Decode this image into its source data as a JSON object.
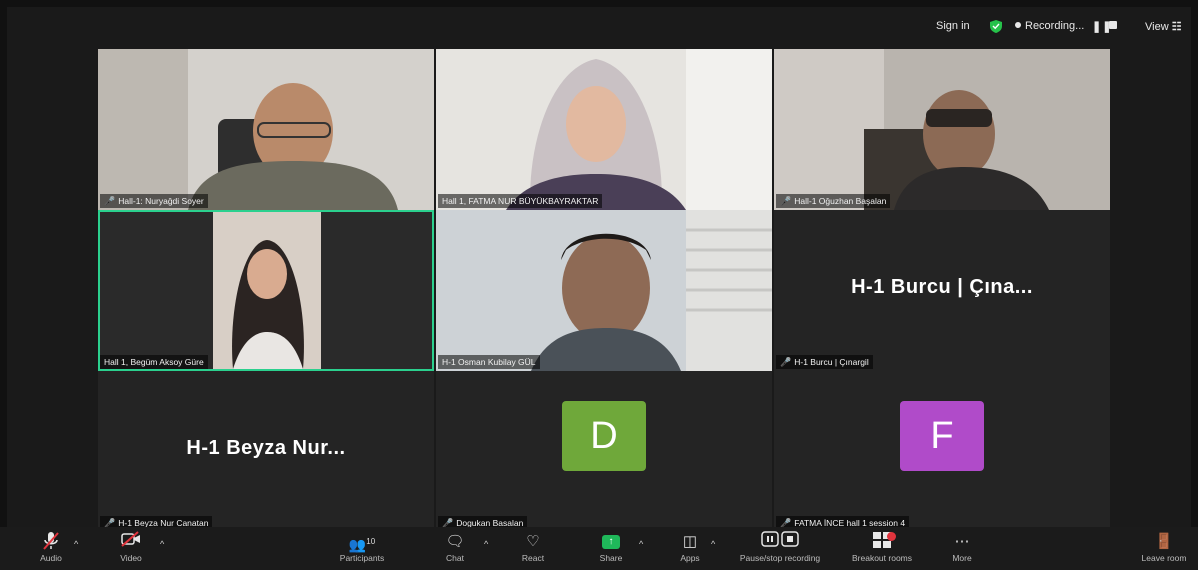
{
  "topbar": {
    "sign_in": "Sign in",
    "recording": "Recording...",
    "view": "View",
    "shield_color": "#26c24a"
  },
  "tiles": [
    {
      "label": "Hall-1: Nuryağdi Soyer",
      "muted": true
    },
    {
      "label": "Hall 1, FATMA NUR BÜYÜKBAYRAKTAR",
      "muted": false
    },
    {
      "label": "Hall-1 Oğuzhan Başalan",
      "muted": true
    },
    {
      "label": "Hall 1, Begüm Aksoy Güre",
      "muted": false,
      "active": true
    },
    {
      "label": "H-1 Osman Kubilay GÜL",
      "muted": false
    },
    {
      "label": "H-1 Burcu | Çınargil",
      "muted": true,
      "display_name": "H-1 Burcu | Çına..."
    },
    {
      "label": "H-1 Beyza Nur Canatan",
      "muted": true,
      "display_name": "H-1 Beyza Nur..."
    },
    {
      "label": "Dogukan Basalan",
      "muted": true,
      "avatar_letter": "D",
      "avatar_color": "#6fa83a"
    },
    {
      "label": "FATMA İNCE hall 1 session 4",
      "muted": true,
      "avatar_letter": "F",
      "avatar_color": "#b04bc9"
    }
  ],
  "toolbar": {
    "audio": "Audio",
    "video": "Video",
    "participants": "Participants",
    "participants_count": "10",
    "chat": "Chat",
    "react": "React",
    "share": "Share",
    "apps": "Apps",
    "pause_stop": "Pause/stop recording",
    "breakout": "Breakout rooms",
    "more": "More",
    "leave": "Leave room"
  }
}
